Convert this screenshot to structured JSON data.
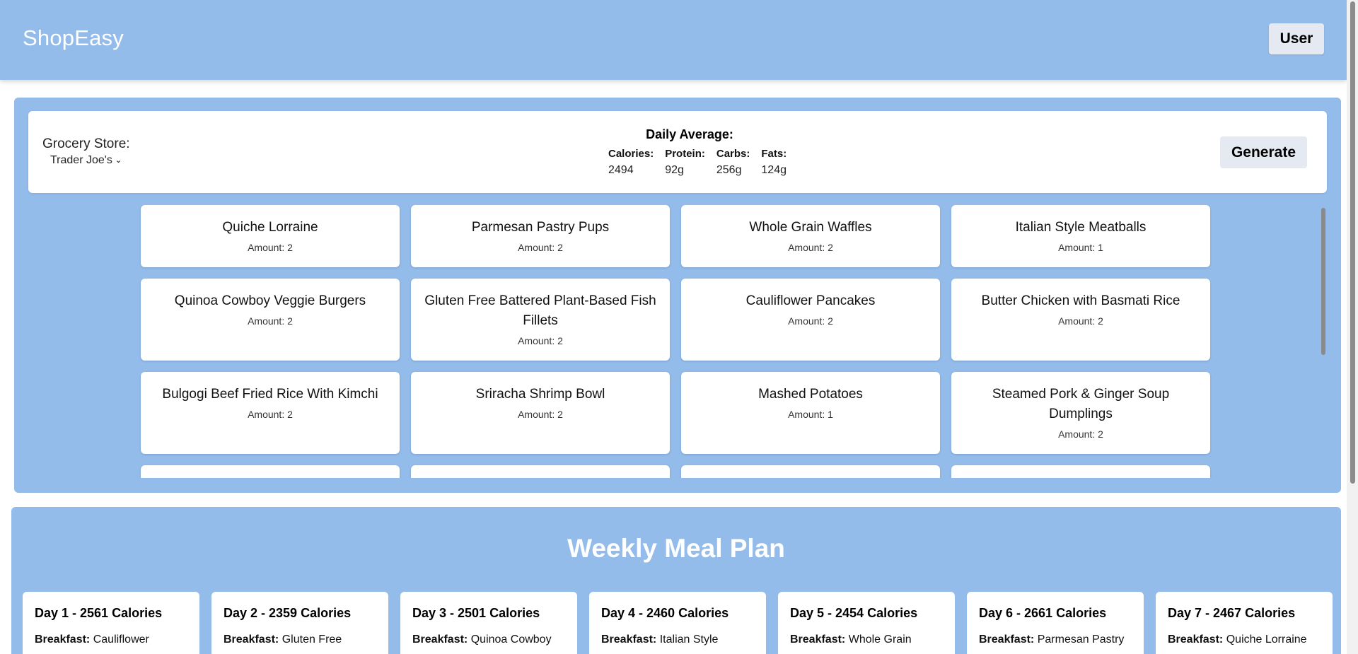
{
  "header": {
    "brand": "ShopEasy",
    "user_label": "User"
  },
  "summary": {
    "store_label": "Grocery Store:",
    "store_value": "Trader Joe's",
    "daily_title": "Daily Average:",
    "macros": [
      {
        "label": "Calories:",
        "value": "2494"
      },
      {
        "label": "Protein:",
        "value": "92g"
      },
      {
        "label": "Carbs:",
        "value": "256g"
      },
      {
        "label": "Fats:",
        "value": "124g"
      }
    ],
    "generate_label": "Generate"
  },
  "meals": [
    {
      "name": "Quiche Lorraine",
      "amount": "Amount: 2"
    },
    {
      "name": "Parmesan Pastry Pups",
      "amount": "Amount: 2"
    },
    {
      "name": "Whole Grain Waffles",
      "amount": "Amount: 2"
    },
    {
      "name": "Italian Style Meatballs",
      "amount": "Amount: 1"
    },
    {
      "name": "Quinoa Cowboy Veggie Burgers",
      "amount": "Amount: 2"
    },
    {
      "name": "Gluten Free Battered Plant-Based Fish Fillets",
      "amount": "Amount: 2"
    },
    {
      "name": "Cauliflower Pancakes",
      "amount": "Amount: 2"
    },
    {
      "name": "Butter Chicken with Basmati Rice",
      "amount": "Amount: 2"
    },
    {
      "name": "Bulgogi Beef Fried Rice With Kimchi",
      "amount": "Amount: 2"
    },
    {
      "name": "Sriracha Shrimp Bowl",
      "amount": "Amount: 2"
    },
    {
      "name": "Mashed Potatoes",
      "amount": "Amount: 1"
    },
    {
      "name": "Steamed Pork & Ginger Soup Dumplings",
      "amount": "Amount: 2"
    }
  ],
  "weekly": {
    "title": "Weekly Meal Plan",
    "breakfast_label": "Breakfast:",
    "days": [
      {
        "title": "Day 1 - 2561 Calories",
        "breakfast": "Cauliflower"
      },
      {
        "title": "Day 2 - 2359 Calories",
        "breakfast": "Gluten Free"
      },
      {
        "title": "Day 3 - 2501 Calories",
        "breakfast": "Quinoa Cowboy"
      },
      {
        "title": "Day 4 - 2460 Calories",
        "breakfast": "Italian Style"
      },
      {
        "title": "Day 5 - 2454 Calories",
        "breakfast": "Whole Grain"
      },
      {
        "title": "Day 6 - 2661 Calories",
        "breakfast": "Parmesan Pastry"
      },
      {
        "title": "Day 7 - 2467 Calories",
        "breakfast": "Quiche Lorraine"
      }
    ]
  }
}
